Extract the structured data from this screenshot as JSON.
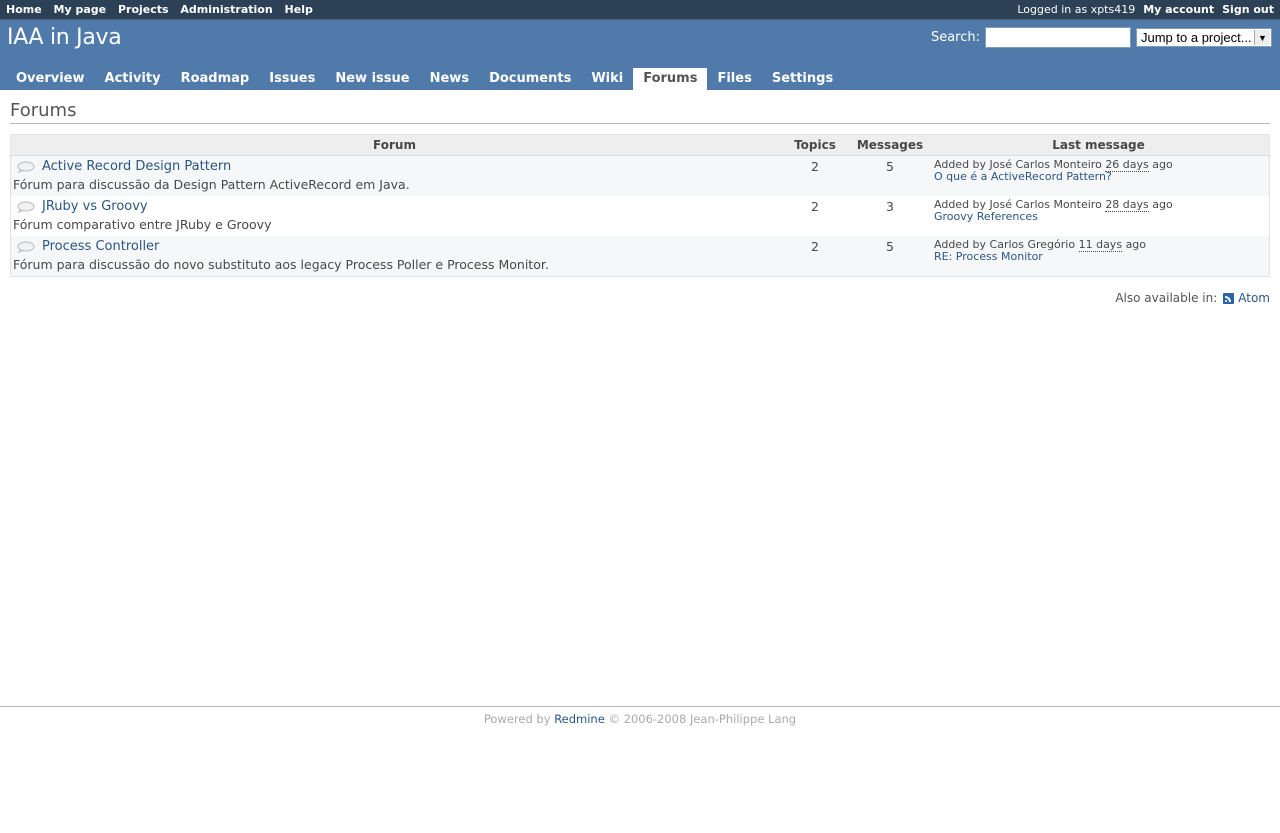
{
  "top_menu": {
    "items": [
      "Home",
      "My page",
      "Projects",
      "Administration",
      "Help"
    ],
    "logged_in_label": "Logged in as",
    "username": "xpts419",
    "my_account": "My account",
    "sign_out": "Sign out"
  },
  "header": {
    "project_title": "IAA in Java",
    "search_label": "Search:",
    "search_value": "",
    "jump_select": "Jump to a project..."
  },
  "main_menu": {
    "tabs": [
      "Overview",
      "Activity",
      "Roadmap",
      "Issues",
      "New issue",
      "News",
      "Documents",
      "Wiki",
      "Forums",
      "Files",
      "Settings"
    ],
    "selected": "Forums"
  },
  "page": {
    "title": "Forums",
    "columns": [
      "Forum",
      "Topics",
      "Messages",
      "Last message"
    ],
    "forums": [
      {
        "name": "Active Record Design Pattern",
        "description": "Fórum para discussão da Design Pattern ActiveRecord em Java.",
        "topics": "2",
        "messages": "5",
        "added_by": "Added by José Carlos Monteiro",
        "ago_value": "26 days",
        "ago_suffix": "ago",
        "last_message": "O que é a ActiveRecord Pattern?"
      },
      {
        "name": "JRuby vs Groovy",
        "description": "Fórum comparativo entre JRuby e Groovy",
        "topics": "2",
        "messages": "3",
        "added_by": "Added by José Carlos Monteiro",
        "ago_value": "28 days",
        "ago_suffix": "ago",
        "last_message": "Groovy References"
      },
      {
        "name": "Process Controller",
        "description": "Fórum para discussão do novo substituto aos legacy Process Poller e Process Monitor.",
        "topics": "2",
        "messages": "5",
        "added_by": "Added by Carlos Gregório",
        "ago_value": "11 days",
        "ago_suffix": "ago",
        "last_message": "RE: Process Monitor"
      }
    ],
    "also_available": "Also available in:",
    "atom": "Atom"
  },
  "footer": {
    "powered_by": "Powered by",
    "redmine": "Redmine",
    "copyright": "© 2006-2008 Jean-Philippe Lang"
  },
  "colors": {
    "top_bar": "#2C4056",
    "header": "#507AAA",
    "link": "#2A5685"
  }
}
